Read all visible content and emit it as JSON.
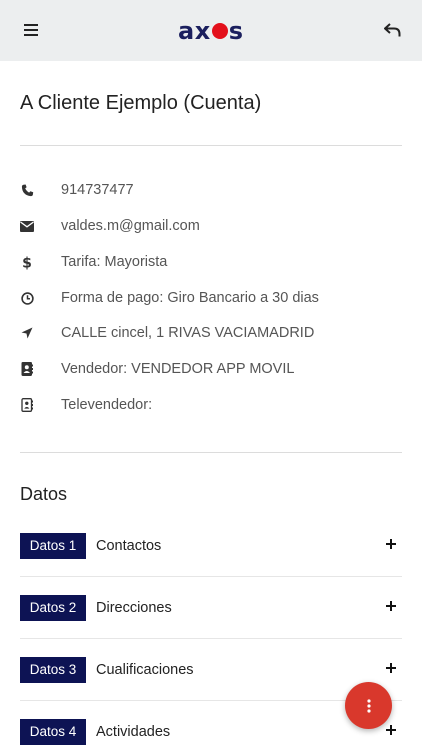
{
  "header": {
    "logo_left": "ax",
    "logo_right": "s",
    "menu_icon": "hamburger-icon",
    "back_icon": "back-arrow-icon"
  },
  "page": {
    "title": "A Cliente Ejemplo (Cuenta)"
  },
  "info": [
    {
      "icon": "phone-icon",
      "value": "914737477"
    },
    {
      "icon": "envelope-icon",
      "value": "valdes.m@gmail.com"
    },
    {
      "icon": "dollar-icon",
      "value": "Tarifa: Mayorista"
    },
    {
      "icon": "clock-icon",
      "value": "Forma de pago: Giro Bancario a 30 dias"
    },
    {
      "icon": "location-arrow-icon",
      "value": "CALLE cincel, 1 RIVAS VACIAMADRID"
    },
    {
      "icon": "contact-card-icon",
      "value": "Vendedor: VENDEDOR APP MOVIL"
    },
    {
      "icon": "contact-card-outline-icon",
      "value": "Televendedor:"
    }
  ],
  "datos": {
    "title": "Datos",
    "items": [
      {
        "badge": "Datos 1",
        "label": "Contactos"
      },
      {
        "badge": "Datos 2",
        "label": "Direcciones"
      },
      {
        "badge": "Datos 3",
        "label": "Cualificaciones"
      },
      {
        "badge": "Datos 4",
        "label": "Actividades"
      }
    ]
  },
  "colors": {
    "header_bg": "#eceeef",
    "brand_navy": "#0d1354",
    "brand_red": "#e3101b",
    "fab": "#d9382c"
  }
}
